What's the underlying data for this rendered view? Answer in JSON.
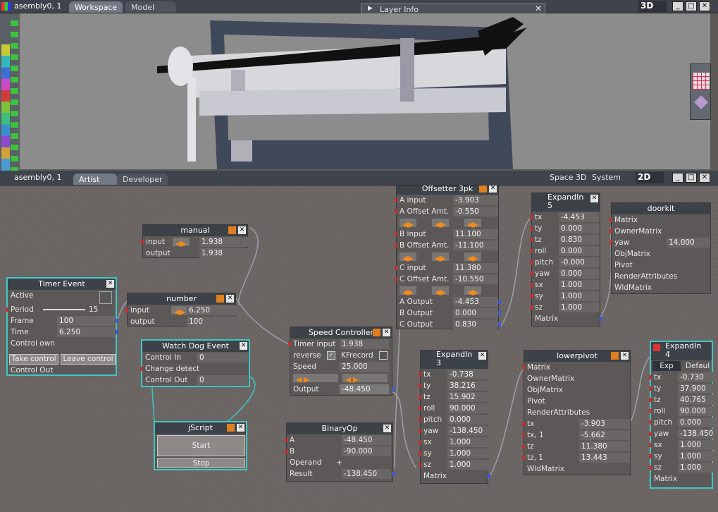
{
  "top": {
    "title": "asembly0, 1",
    "tabs": [
      "Workspace",
      "Model"
    ],
    "layer_info": "Layer Info",
    "mode": "3D"
  },
  "mid": {
    "title": "asembly0, 1",
    "tabs": [
      "Artist",
      "Developer"
    ],
    "space": "Space 3D",
    "system": "System",
    "mode": "2D"
  },
  "manual": {
    "title": "manual",
    "input_label": "input",
    "input_val": "1.938",
    "output_label": "output",
    "output_val": "1.938"
  },
  "timer": {
    "title": "Timer Event",
    "active": "Active",
    "period": "Period",
    "period_val": "15",
    "frame": "Frame",
    "frame_val": "100",
    "time": "Time",
    "time_val": "6.250",
    "control_own": "Control own",
    "take": "Take control",
    "leave": "Leave control",
    "control_out": "Control Out"
  },
  "number": {
    "title": "number",
    "input_label": "input",
    "input_val": "6.250",
    "output_label": "output",
    "output_val": "100"
  },
  "watchdog": {
    "title": "Watch Dog Event",
    "control_in": "Control In",
    "control_in_val": "0",
    "change": "Change detect",
    "control_out": "Control Out",
    "control_out_val": "0"
  },
  "jscript": {
    "title": "jScript",
    "start": "Start",
    "stop": "Stop"
  },
  "speed": {
    "title": "Speed Controller",
    "timer_input": "Timer input",
    "timer_input_val": "1.938",
    "reverse": "reverse",
    "kfrecord": "KFrecord",
    "speed": "Speed",
    "speed_val": "25.000",
    "output": "Output",
    "output_val": "-48.450"
  },
  "binop": {
    "title": "BinaryOp",
    "a": "A",
    "a_val": "-48.450",
    "b": "B",
    "b_val": "-90.000",
    "operand": "Operand",
    "operand_val": "+",
    "result": "Result",
    "result_val": "-138.450"
  },
  "offsetter": {
    "title": "Offsetter 3pk",
    "a_input": "A input",
    "a_input_val": "-3.903",
    "a_off": "A Offset Amt.",
    "a_off_val": "-0.550",
    "b_input": "B input",
    "b_input_val": "11.100",
    "b_off": "B Offset Amt.",
    "b_off_val": "-11.100",
    "c_input": "C input",
    "c_input_val": "11.380",
    "c_off": "C Offset Amt.",
    "c_off_val": "-10.550",
    "a_out": "A Output",
    "a_out_val": "-4.453",
    "b_out": "B Output",
    "b_out_val": "0.000",
    "c_out": "C Output",
    "c_out_val": "0.830"
  },
  "expand5": {
    "title": "ExpandIn",
    "num": "5",
    "rows": [
      [
        "tx",
        "-4.453"
      ],
      [
        "ty",
        "0.000"
      ],
      [
        "tz",
        "0.830"
      ],
      [
        "roll",
        "0.000"
      ],
      [
        "pitch",
        "-0.000"
      ],
      [
        "yaw",
        "0.000"
      ],
      [
        "sx",
        "1.000"
      ],
      [
        "sy",
        "1.000"
      ],
      [
        "sz",
        "1.000"
      ]
    ],
    "matrix": "Matrix"
  },
  "expand3": {
    "title": "ExpandIn",
    "num": "3",
    "rows": [
      [
        "tx",
        "-0.738"
      ],
      [
        "ty",
        "38.216"
      ],
      [
        "tz",
        "15.902"
      ],
      [
        "roll",
        "90.000"
      ],
      [
        "pitch",
        "0.000"
      ],
      [
        "yaw",
        "-138.450"
      ],
      [
        "sx",
        "1.000"
      ],
      [
        "sy",
        "1.000"
      ],
      [
        "sz",
        "1.000"
      ]
    ],
    "matrix": "Matrix"
  },
  "doorkit": {
    "title": "doorkit",
    "rows": [
      "Matrix",
      "OwnerMatrix",
      "yaw",
      "ObjMatrix",
      "Pivot",
      "RenderAttributes",
      "WldMatrix"
    ],
    "yaw_val": "14.000"
  },
  "lowerpivot": {
    "title": "lowerpivot",
    "rows": [
      "Matrix",
      "OwnerMatrix",
      "ObjMatrix",
      "Pivot",
      "RenderAttributes"
    ],
    "vals": [
      [
        "tx",
        "-3.903"
      ],
      [
        "tx, 1",
        "-5.662"
      ],
      [
        "tz",
        "11.380"
      ],
      [
        "tz, 1",
        "13.443"
      ]
    ],
    "wld": "WldMatrix"
  },
  "expand4": {
    "title": "ExpandIn",
    "num": "4",
    "tab_exp": "Exp",
    "tab_def": "Defaul",
    "rows": [
      [
        "tx",
        "-0.730"
      ],
      [
        "ty",
        "37.900"
      ],
      [
        "tz",
        "40.765"
      ],
      [
        "roll",
        "90.000"
      ],
      [
        "pitch",
        "0.000"
      ],
      [
        "yaw",
        "-138.450"
      ],
      [
        "sx",
        "1.000"
      ],
      [
        "sy",
        "1.000"
      ],
      [
        "sz",
        "1.000"
      ]
    ],
    "matrix": "Matrix"
  }
}
